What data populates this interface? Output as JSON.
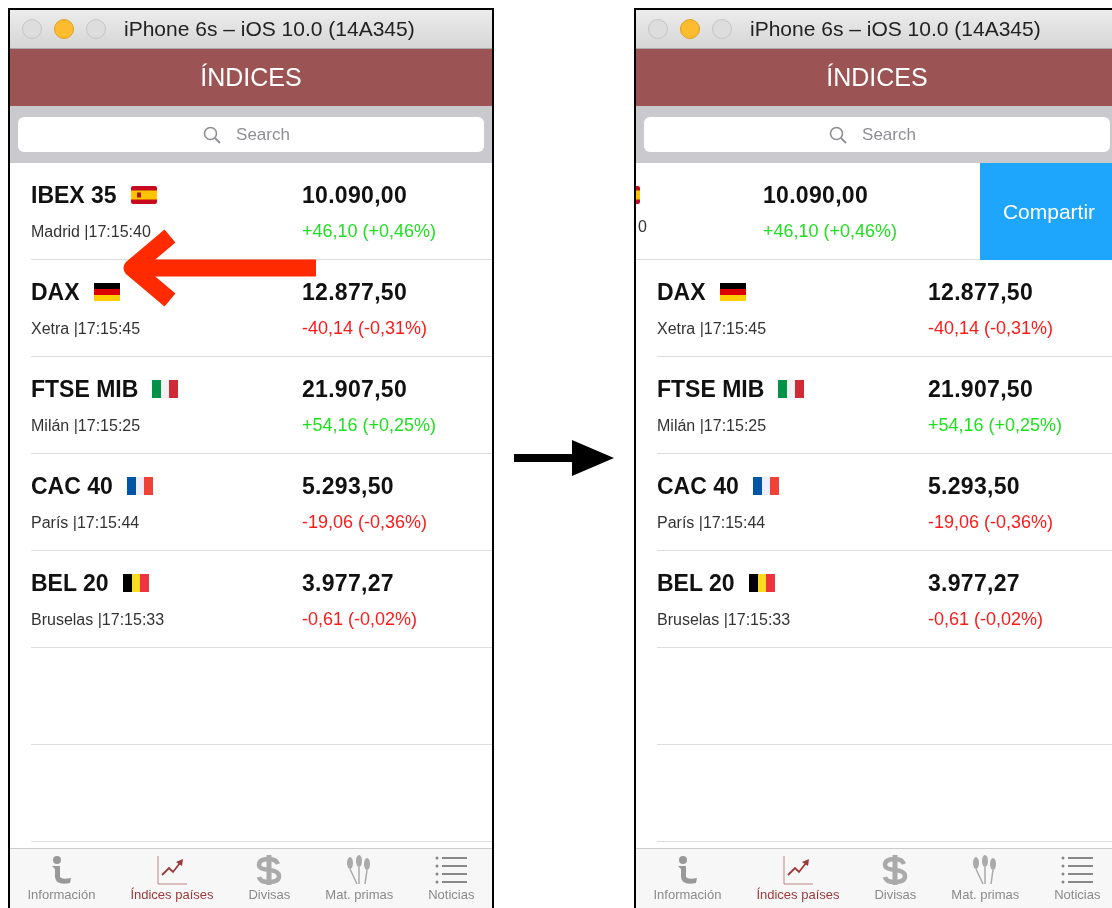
{
  "screens": [
    {
      "window_title": "iPhone 6s – iOS 10.0 (14A345)",
      "header": "ÍNDICES",
      "search": {
        "placeholder": "Search"
      },
      "swipe_arrow": true,
      "rows": [
        {
          "swiped": false,
          "name": "IBEX 35",
          "subtitle": "Madrid |17:15:40",
          "price": "10.090,00",
          "change": "+46,10 (+0,46%)",
          "color": "#1fe01f"
        },
        {
          "swiped": false,
          "name": "DAX",
          "subtitle": "Xetra |17:15:45",
          "price": "12.877,50",
          "change": "-40,14 (-0,31%)",
          "color": "#ff1a1a"
        },
        {
          "swiped": false,
          "name": "FTSE MIB",
          "subtitle": "Milán |17:15:25",
          "price": "21.907,50",
          "change": "+54,16 (+0,25%)",
          "color": "#1fe01f"
        },
        {
          "swiped": false,
          "name": "CAC 40",
          "subtitle": "París |17:15:44",
          "price": "5.293,50",
          "change": "-19,06 (-0,36%)",
          "color": "#ff1a1a"
        },
        {
          "swiped": false,
          "name": "BEL 20",
          "subtitle": "Bruselas |17:15:33",
          "price": "3.977,27",
          "change": "-0,61 (-0,02%)",
          "color": "#ff1a1a"
        }
      ],
      "tabs": [
        {
          "label": "Información",
          "selected": false
        },
        {
          "label": "Índices países",
          "selected": true
        },
        {
          "label": "Divisas",
          "selected": false
        },
        {
          "label": "Mat. primas",
          "selected": false
        },
        {
          "label": "Noticias",
          "selected": false
        }
      ]
    },
    {
      "window_title": "iPhone 6s – iOS 10.0 (14A345)",
      "header": "ÍNDICES",
      "search": {
        "placeholder": "Search"
      },
      "swipe_arrow": false,
      "rows": [
        {
          "swiped": true,
          "subtitle_fragment": "0",
          "price": "10.090,00",
          "change": "+46,10 (+0,46%)",
          "color": "#1fe01f",
          "action": "Compartir"
        },
        {
          "swiped": false,
          "name": "DAX",
          "subtitle": "Xetra |17:15:45",
          "price": "12.877,50",
          "change": "-40,14 (-0,31%)",
          "color": "#ff1a1a"
        },
        {
          "swiped": false,
          "name": "FTSE MIB",
          "subtitle": "Milán |17:15:25",
          "price": "21.907,50",
          "change": "+54,16 (+0,25%)",
          "color": "#1fe01f"
        },
        {
          "swiped": false,
          "name": "CAC 40",
          "subtitle": "París |17:15:44",
          "price": "5.293,50",
          "change": "-19,06 (-0,36%)",
          "color": "#ff1a1a"
        },
        {
          "swiped": false,
          "name": "BEL 20",
          "subtitle": "Bruselas |17:15:33",
          "price": "3.977,27",
          "change": "-0,61 (-0,02%)",
          "color": "#ff1a1a"
        }
      ],
      "tabs": [
        {
          "label": "Información",
          "selected": false
        },
        {
          "label": "Índices países",
          "selected": true
        },
        {
          "label": "Divisas",
          "selected": false
        },
        {
          "label": "Mat. primas",
          "selected": false
        },
        {
          "label": "Noticias",
          "selected": false
        }
      ]
    }
  ],
  "transition_arrow": true
}
